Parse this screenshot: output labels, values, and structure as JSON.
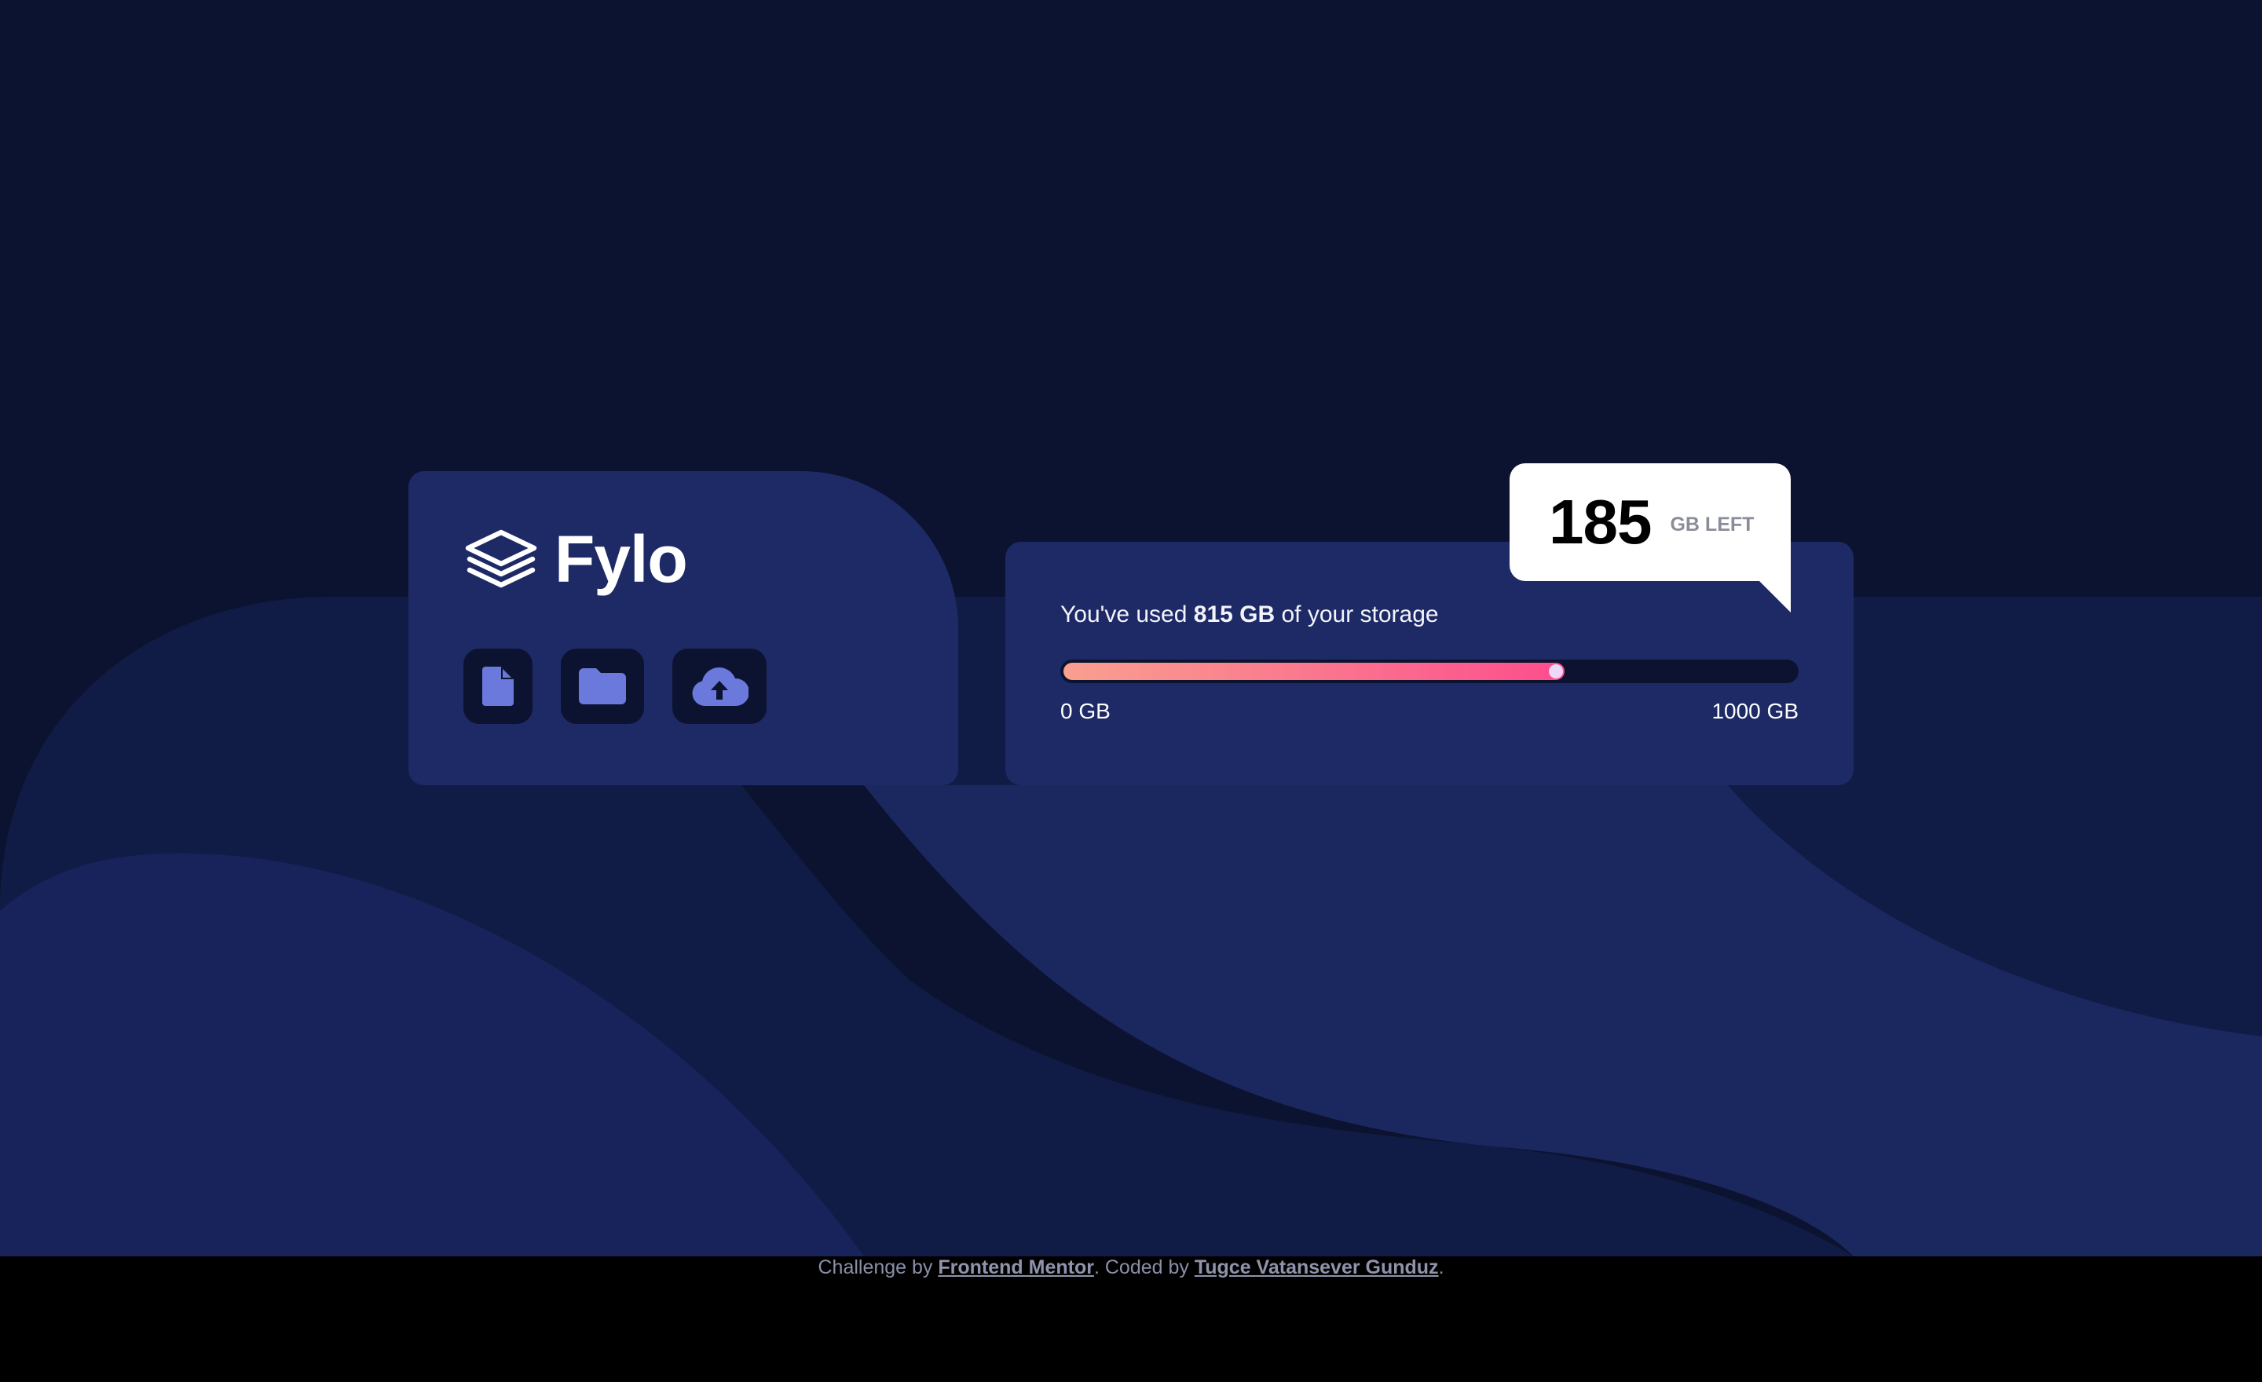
{
  "app": {
    "name": "Fylo"
  },
  "colors": {
    "page_bg": "#0c1330",
    "card_bg": "#1e2a66",
    "icon_color": "#6a79db",
    "meter_gradient_start": "#f9a08f",
    "meter_gradient_end": "#fc4d8d"
  },
  "brand": {
    "logo_icon": "stacked-layers-icon",
    "tools": [
      {
        "name": "document-button",
        "icon": "document-icon"
      },
      {
        "name": "folder-button",
        "icon": "folder-icon"
      },
      {
        "name": "upload-button",
        "icon": "cloud-upload-icon"
      }
    ]
  },
  "storage": {
    "prefix": "You've used ",
    "used": "815 GB",
    "suffix": " of your storage",
    "min_label": "0 GB",
    "max_label": "1000 GB",
    "used_fraction": 0.685
  },
  "remaining": {
    "value": "185",
    "label": "GB LEFT"
  },
  "footer": {
    "text_1": "Challenge by ",
    "link_1": "Frontend Mentor",
    "text_2": ". Coded by ",
    "link_2": "Tugce Vatansever Gunduz",
    "text_3": "."
  }
}
